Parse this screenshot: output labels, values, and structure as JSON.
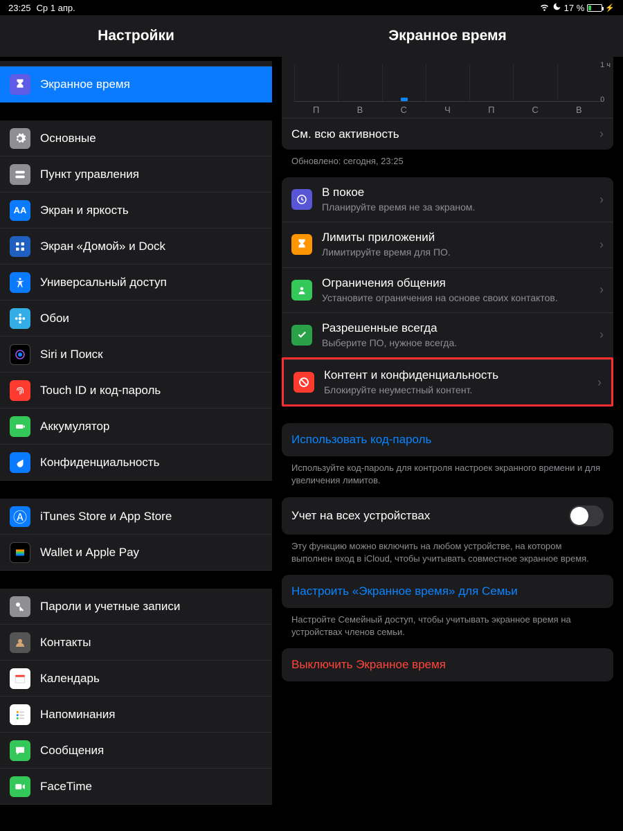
{
  "status": {
    "time": "23:25",
    "date": "Ср 1 апр.",
    "battery_pct": "17 %"
  },
  "sidebar": {
    "title": "Настройки",
    "items": [
      {
        "label": "Экранное время"
      },
      {
        "label": "Основные"
      },
      {
        "label": "Пункт управления"
      },
      {
        "label": "Экран и яркость"
      },
      {
        "label": "Экран «Домой» и Dock"
      },
      {
        "label": "Универсальный доступ"
      },
      {
        "label": "Обои"
      },
      {
        "label": "Siri и Поиск"
      },
      {
        "label": "Touch ID и код-пароль"
      },
      {
        "label": "Аккумулятор"
      },
      {
        "label": "Конфиденциальность"
      },
      {
        "label": "iTunes Store и App Store"
      },
      {
        "label": "Wallet и Apple Pay"
      },
      {
        "label": "Пароли и учетные записи"
      },
      {
        "label": "Контакты"
      },
      {
        "label": "Календарь"
      },
      {
        "label": "Напоминания"
      },
      {
        "label": "Сообщения"
      },
      {
        "label": "FaceTime"
      }
    ]
  },
  "detail": {
    "title": "Экранное время",
    "see_all": "См. всю активность",
    "updated": "Обновлено: сегодня, 23:25",
    "options": [
      {
        "title": "В покое",
        "sub": "Планируйте время не за экраном."
      },
      {
        "title": "Лимиты приложений",
        "sub": "Лимитируйте время для ПО."
      },
      {
        "title": "Ограничения общения",
        "sub": "Установите ограничения на основе своих контактов."
      },
      {
        "title": "Разрешенные всегда",
        "sub": "Выберите ПО, нужное всегда."
      },
      {
        "title": "Контент и конфиденциальность",
        "sub": "Блокируйте неуместный контент."
      }
    ],
    "passcode": "Использовать код-пароль",
    "passcode_hint": "Используйте код-пароль для контроля настроек экранного времени и для увеличения лимитов.",
    "devices": "Учет на всех устройствах",
    "devices_hint": "Эту функцию можно включить на любом устройстве, на котором выполнен вход в iCloud, чтобы учитывать совместное экранное время.",
    "family": "Настроить «Экранное время» для Семьи",
    "family_hint": "Настройте Семейный доступ, чтобы учитывать экранное время на устройствах членов семьи.",
    "off": "Выключить Экранное время"
  },
  "chart_data": {
    "type": "bar",
    "categories": [
      "П",
      "В",
      "С",
      "Ч",
      "П",
      "С",
      "В"
    ],
    "values": [
      0,
      0,
      1,
      0,
      0,
      0,
      0
    ],
    "ylim": [
      0,
      14
    ],
    "yticks": [
      "1 ч",
      "0"
    ]
  }
}
